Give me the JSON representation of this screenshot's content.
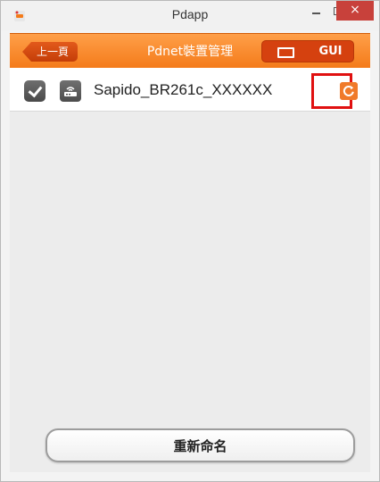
{
  "window": {
    "title": "Pdapp",
    "close_label": "×",
    "minimize_label": "",
    "maximize_label": ""
  },
  "header": {
    "back_label": "上一頁",
    "title": "Pdnet裝置管理",
    "mode_screen_icon": "screen-icon",
    "mode_gui_label": "GUI"
  },
  "devices": [
    {
      "name": "Sapido_BR261c_XXXXXX",
      "checked": true,
      "icon": "router-icon"
    }
  ],
  "actions": {
    "refresh_icon": "refresh-icon",
    "rename_label": "重新命名"
  },
  "colors": {
    "accent": "#F47B1A",
    "highlight": "#E01010"
  }
}
